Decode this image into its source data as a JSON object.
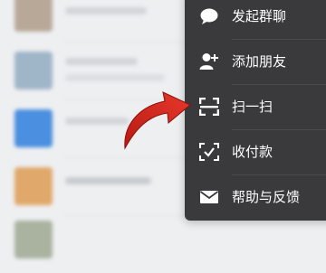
{
  "menu": {
    "items": [
      {
        "label": "发起群聊",
        "icon": "chat-bubble-icon"
      },
      {
        "label": "添加朋友",
        "icon": "add-friend-icon"
      },
      {
        "label": "扫一扫",
        "icon": "scan-icon"
      },
      {
        "label": "收付款",
        "icon": "payment-scan-icon"
      },
      {
        "label": "帮助与反馈",
        "icon": "mail-icon"
      }
    ],
    "background": "#3a3a3c",
    "text_color": "#ffffff"
  },
  "annotation": {
    "icon": "red-curved-arrow-icon",
    "color": "#d4261c"
  }
}
